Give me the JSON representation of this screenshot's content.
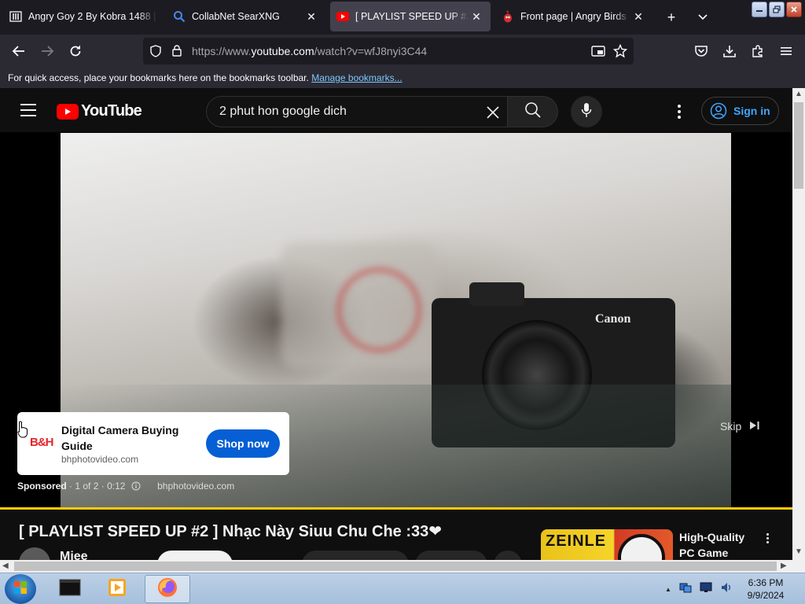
{
  "browser": {
    "tabs": [
      {
        "title": "Angry Goy 2 By Kobra 1488 |",
        "icon": "library-icon",
        "active": false
      },
      {
        "title": "CollabNet SearXNG",
        "icon": "search-icon",
        "active": false
      },
      {
        "title": "[ PLAYLIST SPEED UP #2 ] Nh",
        "icon": "youtube-icon",
        "active": true
      },
      {
        "title": "Front page | Angry Birds",
        "icon": "angry-birds-icon",
        "active": false
      }
    ],
    "url_prefix": "https://www.",
    "url_domain": "youtube.com",
    "url_path": "/watch?v=wfJ8nyi3C44",
    "bookmarks_message": "For quick access, place your bookmarks here on the bookmarks toolbar.",
    "bookmarks_link": "Manage bookmarks..."
  },
  "youtube": {
    "logo_text": "YouTube",
    "search_value": "2 phut hon google dich",
    "sign_in": "Sign in",
    "ad": {
      "logo": "B&H",
      "title": "Digital Camera Buying Guide",
      "domain": "bhphotovideo.com",
      "cta": "Shop now",
      "sponsored": "Sponsored",
      "position": "1 of 2",
      "time": "0:12",
      "meta_domain": "bhphotovideo.com",
      "skip": "Skip"
    },
    "video_title": "[ PLAYLIST SPEED UP #2 ] Nhạc Này Siuu Chu Che :33❤",
    "channel_name": "Miee",
    "recommended": {
      "title": "High-Quality PC Game",
      "thumb_text": "ZEINLE"
    }
  },
  "taskbar": {
    "time": "6:36 PM",
    "date": "9/9/2024"
  },
  "colors": {
    "accent_link": "#3ea6ff",
    "cta_blue": "#065fd4",
    "progress_yellow": "#ffcc00",
    "yt_red": "#ff0000"
  }
}
